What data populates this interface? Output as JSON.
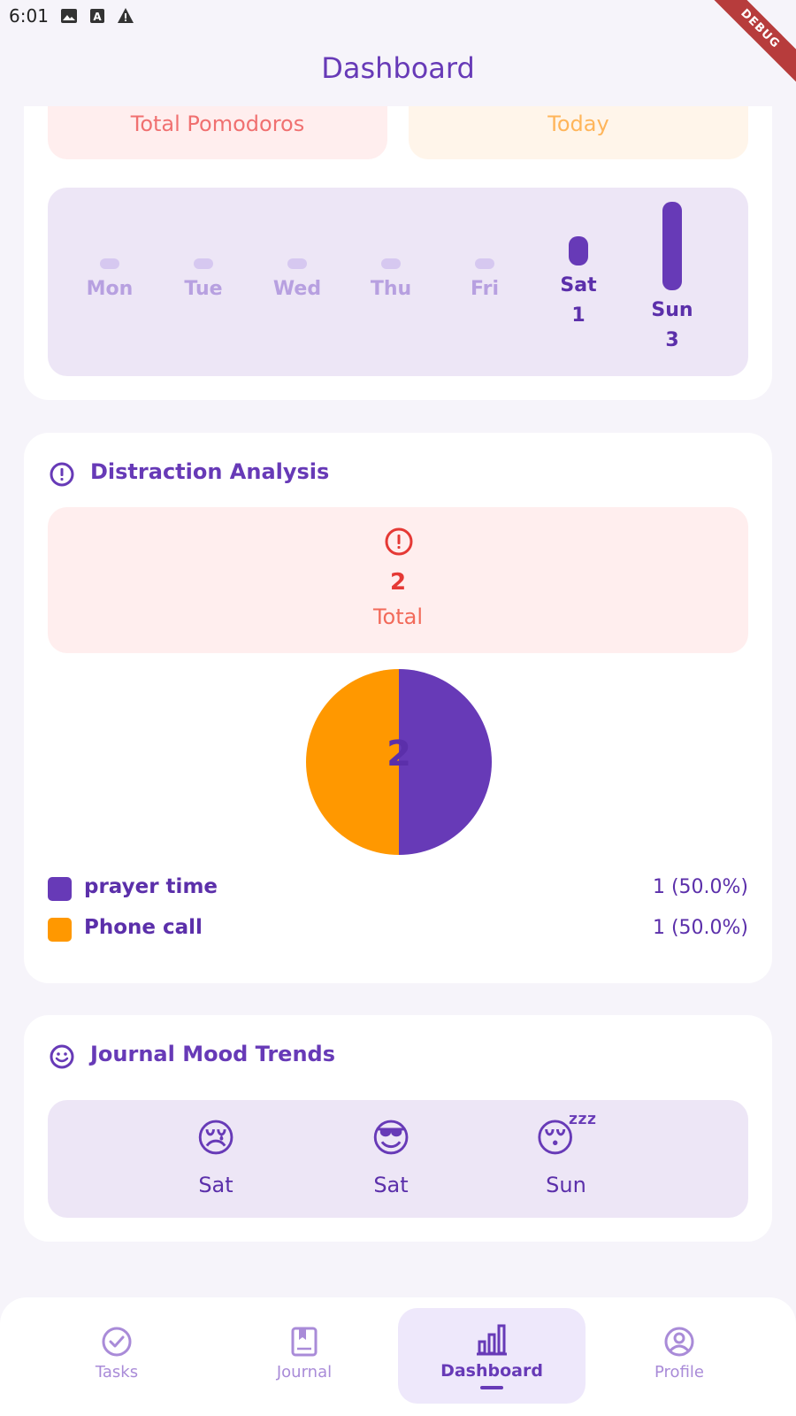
{
  "status_bar": {
    "time": "6:01",
    "icons": [
      "image-icon",
      "text-icon",
      "warning-icon"
    ],
    "debug_label": "DEBUG"
  },
  "app_bar": {
    "title": "Dashboard"
  },
  "stats": {
    "total_pomodoros_label": "Total Pomodoros",
    "today_label": "Today"
  },
  "weekly": {
    "days": [
      {
        "label": "Mon",
        "count": 0
      },
      {
        "label": "Tue",
        "count": 0
      },
      {
        "label": "Wed",
        "count": 0
      },
      {
        "label": "Thu",
        "count": 0
      },
      {
        "label": "Fri",
        "count": 0
      },
      {
        "label": "Sat",
        "count": 1,
        "count_label": "1"
      },
      {
        "label": "Sun",
        "count": 3,
        "count_label": "3"
      }
    ]
  },
  "distraction": {
    "title": "Distraction Analysis",
    "total_value": "2",
    "total_label": "Total",
    "pie_center": "2",
    "items": [
      {
        "label": "prayer time",
        "value": "1 (50.0%)",
        "color": "#673AB7",
        "fraction": 0.5
      },
      {
        "label": "Phone call",
        "value": "1 (50.0%)",
        "color": "#FF9800",
        "fraction": 0.5
      }
    ]
  },
  "mood": {
    "title": "Journal Mood Trends",
    "entries": [
      {
        "emoji": "😢",
        "day": "Sat"
      },
      {
        "emoji": "😎",
        "day": "Sat"
      },
      {
        "emoji": "😴",
        "day": "Sun"
      }
    ]
  },
  "nav": {
    "items": [
      {
        "label": "Tasks",
        "icon": "check-circle-icon"
      },
      {
        "label": "Journal",
        "icon": "book-icon"
      },
      {
        "label": "Dashboard",
        "icon": "bar-chart-icon",
        "active": true
      },
      {
        "label": "Profile",
        "icon": "account-circle-icon"
      }
    ]
  },
  "colors": {
    "accent": "#673AB7",
    "orange": "#FF9800",
    "error": "#E53935"
  }
}
